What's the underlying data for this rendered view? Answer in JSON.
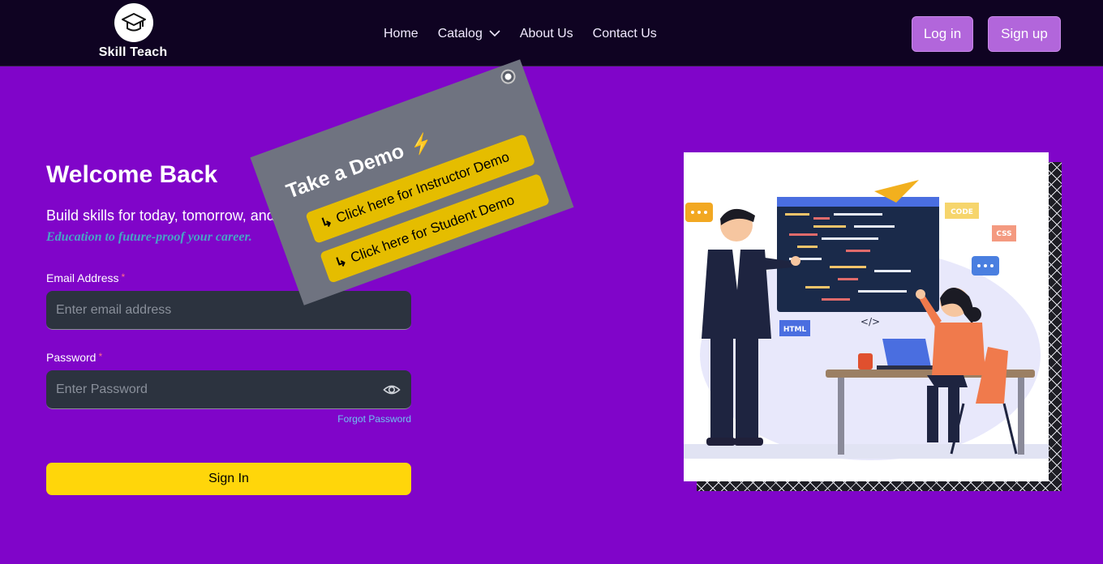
{
  "brand": {
    "name": "Skill Teach"
  },
  "nav": {
    "links": [
      "Home",
      "Catalog",
      "About Us",
      "Contact Us"
    ],
    "login_label": "Log in",
    "signup_label": "Sign up"
  },
  "form": {
    "heading": "Welcome Back",
    "subtitle": "Build skills for today, tomorrow, and beyond.",
    "tagline": "Education to future-proof your career.",
    "email_label": "Email Address",
    "email_placeholder": "Enter email address",
    "password_label": "Password",
    "password_placeholder": "Enter Password",
    "required_mark": "*",
    "forgot_label": "Forgot Password",
    "submit_label": "Sign In"
  },
  "demo": {
    "title": "Take a Demo",
    "instructor_label": "Click here for Instructor Demo",
    "student_label": "Click here for Student Demo"
  },
  "illustration": {
    "tags": [
      "CODE",
      "CSS",
      "HTML",
      "</>"
    ]
  },
  "colors": {
    "page_bg": "#8005c9",
    "nav_bg": "#0f0322",
    "nav_button": "#b266db",
    "accent_yellow": "#ffd60a",
    "demo_card": "#6f7380",
    "tagline": "#47a5c5"
  }
}
